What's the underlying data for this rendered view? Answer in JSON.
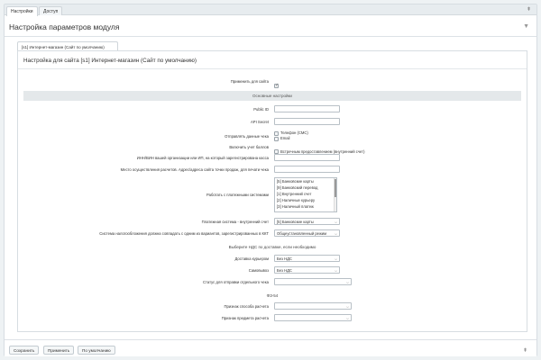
{
  "tabs": [
    {
      "label": "Настройки",
      "active": true
    },
    {
      "label": "Доступ",
      "active": false
    }
  ],
  "page_title": "Настройка параметров модуля",
  "subtab": "[s1] Интернет-магазин (Сайт по умолчанию)",
  "panel_title": "Настройка для сайта [s1] Интернет-магазин (Сайт по умолчанию)",
  "apply": {
    "label": "Применить для сайта",
    "checked": true
  },
  "section_main": "Основные настройки",
  "fields": {
    "public_id": {
      "label": "Public ID",
      "value": ""
    },
    "api_secret": {
      "label": "API Secret",
      "value": ""
    },
    "send_receipt": {
      "label": "Отправлять данные чека",
      "options": [
        {
          "label": "Телефон (СМС)",
          "checked": false
        },
        {
          "label": "Email",
          "checked": false
        }
      ]
    },
    "points": {
      "label": "Включить учет баллов",
      "option": "Встречным предоставлением (внутренний счет)",
      "checked": false
    },
    "inn": {
      "label": "ИНН/ВИН вашей организации или ИП, на который зарегистрирована касса",
      "value": ""
    },
    "place": {
      "label": "Место осуществления расчетов. Адрес/адреса сайта точки продаж, для печати чека",
      "value": ""
    },
    "payment_systems": {
      "label": "Работать с платежными системами",
      "options": [
        "[5] Банковские карты",
        "[9] Банковский перевод",
        "[1] Внутренний счет",
        "[2] Наличные курьеру",
        "[3] Наличный платеж"
      ]
    },
    "internal_ps": {
      "label": "Платежная система - внутренний счет",
      "value": "[5] Банковские карты"
    },
    "tax_system": {
      "label": "Система налогообложения должна совпадать с одним из вариантов, зарегистрированных в ККТ",
      "value": "Общеустановленный режим"
    }
  },
  "vat_section": "Выберите НДС по доставке, если необходимо",
  "vat": {
    "courier": {
      "label": "Доставка курьером",
      "value": "Без НДС"
    },
    "pickup": {
      "label": "Самовывоз",
      "value": "Без НДС"
    },
    "status": {
      "label": "Статус для отправки отдельного чека",
      "value": ""
    }
  },
  "fz_section": "ФЗ-54",
  "fz": {
    "method": {
      "label": "Признак способа расчета",
      "value": ""
    },
    "subject": {
      "label": "Признак предмета расчета",
      "value": ""
    }
  },
  "footer": {
    "save": "Сохранить",
    "apply": "Применить",
    "default": "По умолчанию"
  }
}
